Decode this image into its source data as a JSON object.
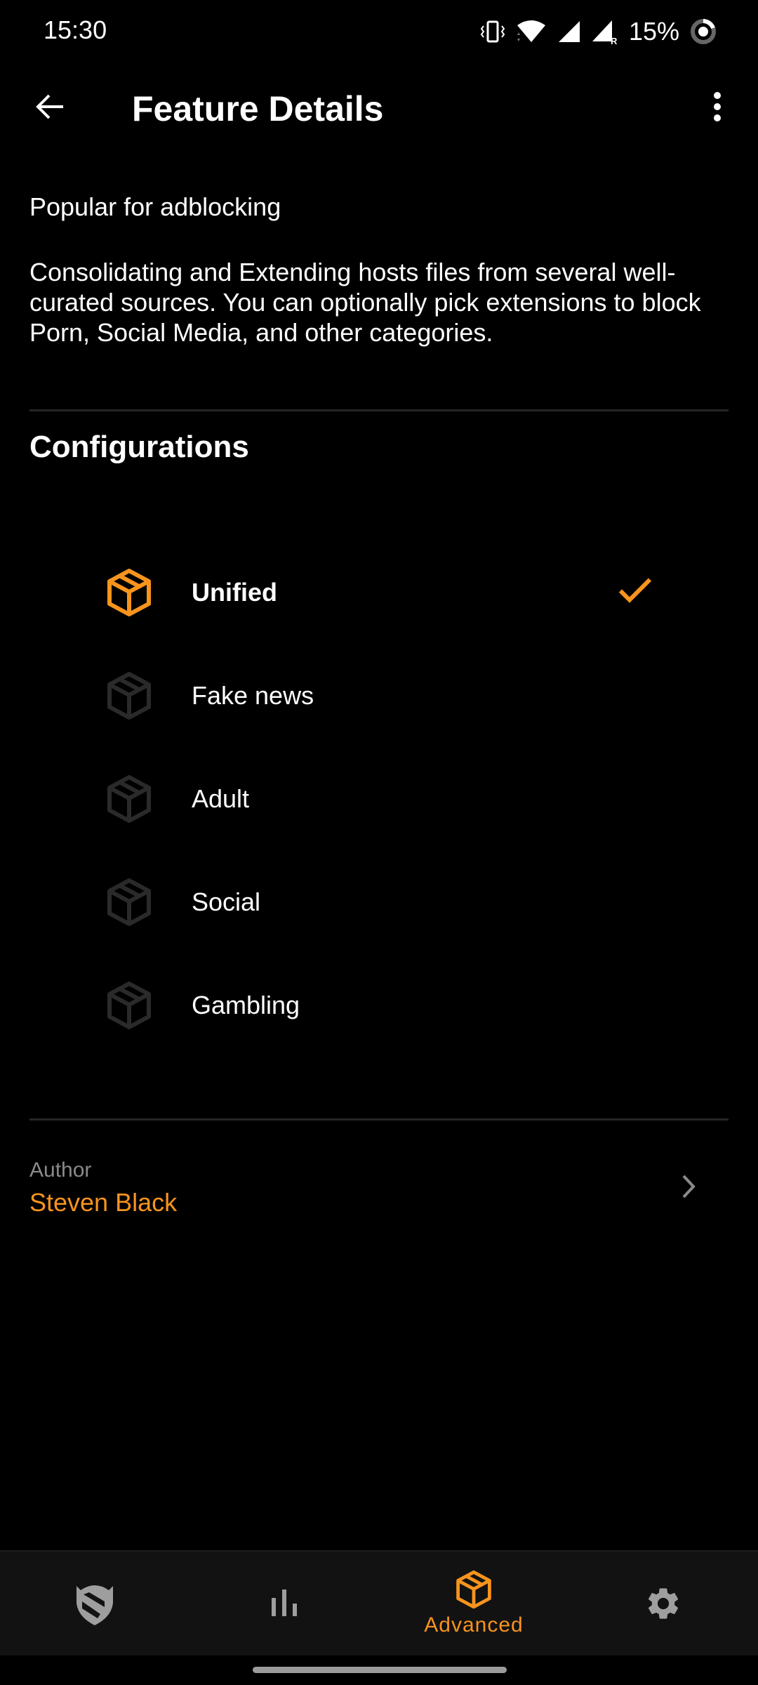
{
  "status_bar": {
    "time": "15:30",
    "battery_percent": "15%",
    "icons": [
      "vibrate-icon",
      "wifi-icon",
      "signal-icon",
      "signal-roaming-icon",
      "battery-saver-icon"
    ]
  },
  "app_bar": {
    "title": "Feature Details",
    "back_icon": "arrow-left-icon",
    "menu_icon": "more-vert-icon"
  },
  "feature": {
    "subtitle": "Popular for adblocking",
    "description": "Consolidating and Extending hosts files from several well-curated sources. You can optionally pick extensions to block Porn, Social Media, and other categories."
  },
  "configurations": {
    "title": "Configurations",
    "items": [
      {
        "label": "Unified",
        "icon": "package-icon",
        "selected": true
      },
      {
        "label": "Fake news",
        "icon": "package-icon",
        "selected": false
      },
      {
        "label": "Adult",
        "icon": "package-icon",
        "selected": false
      },
      {
        "label": "Social",
        "icon": "package-icon",
        "selected": false
      },
      {
        "label": "Gambling",
        "icon": "package-icon",
        "selected": false
      }
    ]
  },
  "author": {
    "label": "Author",
    "name": "Steven Black"
  },
  "bottom_nav": {
    "items": [
      {
        "id": "home",
        "icon": "shield-icon",
        "label": "",
        "active": false
      },
      {
        "id": "stats",
        "icon": "bar-chart-icon",
        "label": "",
        "active": false
      },
      {
        "id": "advanced",
        "icon": "package-icon",
        "label": "Advanced",
        "active": true
      },
      {
        "id": "settings",
        "icon": "gear-icon",
        "label": "",
        "active": false
      }
    ]
  },
  "colors": {
    "accent": "#f7941d",
    "background": "#000000",
    "nav_background": "#121212",
    "inactive_icon": "#9e9e9e",
    "disabled_icon": "#2a2a2a",
    "divider": "#262626"
  }
}
